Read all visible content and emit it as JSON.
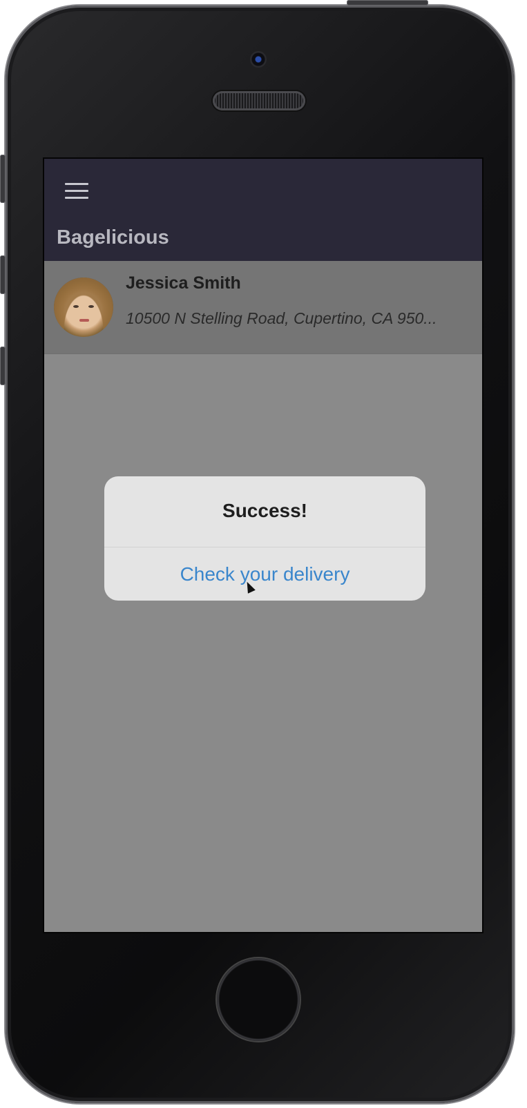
{
  "app": {
    "title": "Bagelicious"
  },
  "navbar": {
    "menu_icon": "hamburger-menu-icon"
  },
  "customers": [
    {
      "name": "Jessica Smith",
      "address": "10500 N Stelling Road, Cupertino, CA 950...",
      "avatar_icon": "user-photo"
    }
  ],
  "alert": {
    "title": "Success!",
    "action_label": "Check your delivery",
    "action_color": "#3a86cc"
  },
  "colors": {
    "navbar": "#2a2838",
    "overlay": "#8a8a8a",
    "alert_background": "#e4e4e4"
  }
}
